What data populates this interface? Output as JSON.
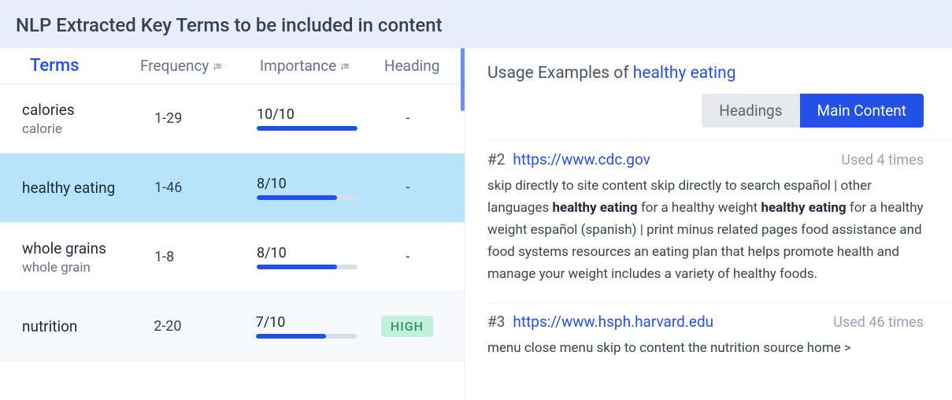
{
  "banner": {
    "title": "NLP Extracted Key Terms to be included in content"
  },
  "table": {
    "headers": {
      "terms": "Terms",
      "frequency": "Frequency",
      "importance": "Importance",
      "heading": "Heading"
    },
    "rows": [
      {
        "term": "calories",
        "sub": "calorie",
        "frequency": "1-29",
        "importance_label": "10/10",
        "importance_pct": 100,
        "heading": "-",
        "heading_badge": null,
        "selected": false,
        "alt": false
      },
      {
        "term": "healthy eating",
        "sub": "",
        "frequency": "1-46",
        "importance_label": "8/10",
        "importance_pct": 80,
        "heading": "-",
        "heading_badge": null,
        "selected": true,
        "alt": false
      },
      {
        "term": "whole grains",
        "sub": "whole grain",
        "frequency": "1-8",
        "importance_label": "8/10",
        "importance_pct": 80,
        "heading": "-",
        "heading_badge": null,
        "selected": false,
        "alt": false
      },
      {
        "term": "nutrition",
        "sub": "",
        "frequency": "2-20",
        "importance_label": "7/10",
        "importance_pct": 70,
        "heading": "",
        "heading_badge": "HIGH",
        "selected": false,
        "alt": true
      }
    ]
  },
  "usage": {
    "title_prefix": "Usage Examples of ",
    "keyword": "healthy eating",
    "toggles": {
      "headings": "Headings",
      "main_content": "Main Content"
    },
    "examples": [
      {
        "rank": "#2",
        "url": "https://www.cdc.gov",
        "count": "Used 4 times",
        "text_segments": [
          {
            "t": "skip directly to site content skip directly to search español | other languages ",
            "b": false
          },
          {
            "t": "healthy eating",
            "b": true
          },
          {
            "t": " for a healthy weight ",
            "b": false
          },
          {
            "t": "healthy eating",
            "b": true
          },
          {
            "t": " for a healthy weight español (spanish) | print minus related pages food assistance and food systems resources an eating plan that helps promote health and manage your weight includes a variety of healthy foods.",
            "b": false
          }
        ]
      },
      {
        "rank": "#3",
        "url": "https://www.hsph.harvard.edu",
        "count": "Used 46 times",
        "text_segments": [
          {
            "t": "menu close menu skip to content the nutrition source home >",
            "b": false
          }
        ]
      }
    ]
  }
}
